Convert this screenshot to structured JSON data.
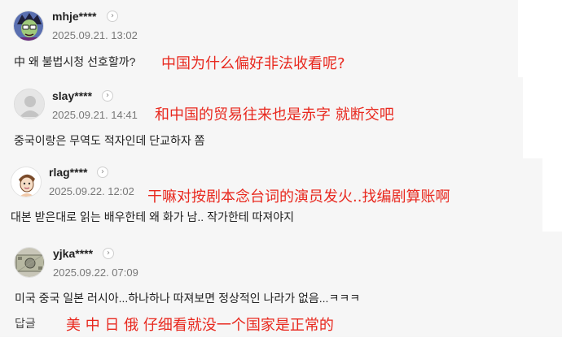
{
  "comments": [
    {
      "username": "mhje****",
      "date": "2025.09.21. 13:02",
      "text": "中 왜 불법시청 선호할까?",
      "translation": "中国为什么偏好非法收看呢?",
      "avatar": "cartoon-character-avatar"
    },
    {
      "username": "slay****",
      "date": "2025.09.21. 14:41",
      "text": "중국이랑은 무역도 적자인데 단교하자 쫌",
      "translation": "和中国的贸易往来也是赤字 就断交吧",
      "avatar": "default-user-avatar"
    },
    {
      "username": "rlag****",
      "date": "2025.09.22. 12:02",
      "text": "대본 받은대로 읽는 배우한테 왜 화가 남.. 작가한테 따져야지",
      "translation": "干嘛对按剧本念台词的演员发火..找编剧算账啊",
      "avatar": "drawn-character-avatar"
    },
    {
      "username": "yjka****",
      "date": "2025.09.22. 07:09",
      "text": "미국 중국 일본 러시아...하나하나 따져보면 정상적인 나라가 없음...ㅋㅋㅋ",
      "translation": "美 中 日 俄 仔细看就没一个国家是正常的",
      "avatar": "banknote-avatar",
      "reply_label": "답글"
    }
  ],
  "icons": {
    "chevron": "›"
  }
}
